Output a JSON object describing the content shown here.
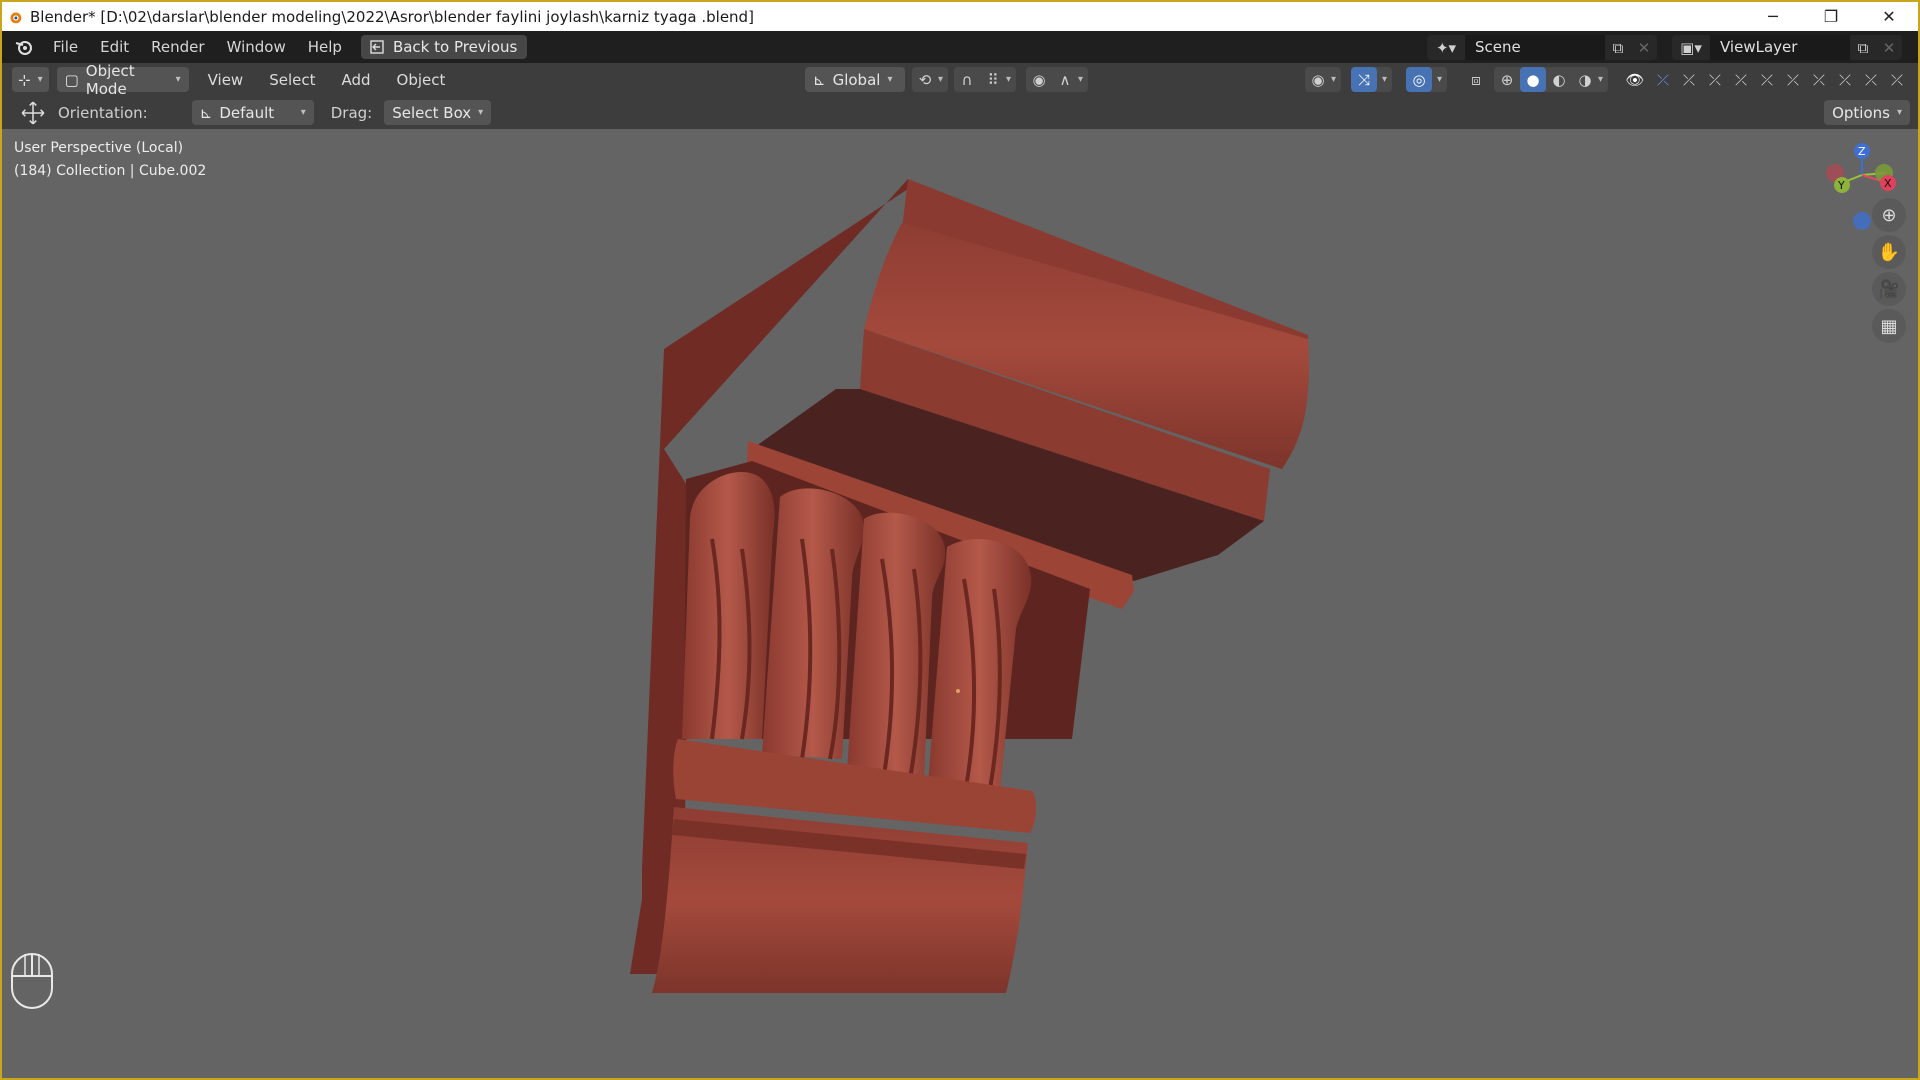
{
  "window": {
    "title": "Blender* [D:\\02\\darslar\\blender modeling\\2022\\Asror\\blender faylini joylash\\karniz tyaga .blend]",
    "controls": {
      "minimize": "─",
      "maximize": "❐",
      "close": "✕"
    }
  },
  "topbar": {
    "menus": [
      "File",
      "Edit",
      "Render",
      "Window",
      "Help"
    ],
    "back_button": "Back to Previous",
    "scene": "Scene",
    "view_layer": "ViewLayer"
  },
  "viewport_header": {
    "mode": "Object Mode",
    "menus": [
      "View",
      "Select",
      "Add",
      "Object"
    ],
    "transform_orientation": "Global"
  },
  "tool_header": {
    "orientation_label": "Orientation:",
    "orientation_value": "Default",
    "drag_label": "Drag:",
    "drag_value": "Select Box",
    "options": "Options"
  },
  "viewport": {
    "perspective": "User Perspective (Local)",
    "collection": "(184) Collection | Cube.002",
    "gizmo": {
      "z": "Z",
      "y": "Y",
      "x": "X"
    },
    "object_color": "#8e3d33"
  }
}
